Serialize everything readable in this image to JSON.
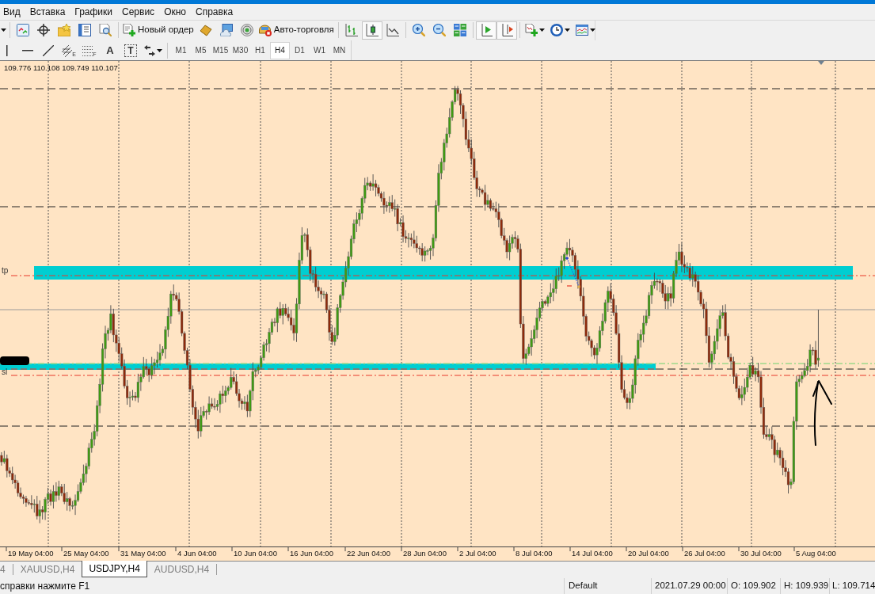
{
  "menu": [
    {
      "label": "Вид"
    },
    {
      "label": "Вставка"
    },
    {
      "label": "Графики"
    },
    {
      "label": "Сервис"
    },
    {
      "label": "Окно"
    },
    {
      "label": "Справка"
    }
  ],
  "toolbar": {
    "new_order": "Новый ордер",
    "auto_trading": "Авто-торговля",
    "chart_types": [
      {
        "kind": "bars",
        "selected": false
      },
      {
        "kind": "candles",
        "selected": true
      },
      {
        "kind": "line",
        "selected": false
      }
    ],
    "auto_scroll": {
      "on": true
    },
    "chart_shift": {
      "on": true
    }
  },
  "drawing_tools": [
    {
      "kind": "vertical_line"
    },
    {
      "kind": "horizontal_line"
    },
    {
      "kind": "trendline"
    },
    {
      "kind": "channel",
      "mark": "E"
    },
    {
      "kind": "fibonacci",
      "mark": "F"
    },
    {
      "kind": "text",
      "mark": "A"
    },
    {
      "kind": "text_label",
      "mark": "T"
    },
    {
      "kind": "arrows"
    }
  ],
  "timeframes": [
    {
      "label": "M1",
      "selected": false
    },
    {
      "label": "M5",
      "selected": false
    },
    {
      "label": "M15",
      "selected": false
    },
    {
      "label": "M30",
      "selected": false
    },
    {
      "label": "H1",
      "selected": false
    },
    {
      "label": "H4",
      "selected": true
    },
    {
      "label": "D1",
      "selected": false
    },
    {
      "label": "W1",
      "selected": false
    },
    {
      "label": "MN",
      "selected": false
    }
  ],
  "chart": {
    "ohlc": "109.776 110.108 109.749 110.107",
    "tp_label": "tp",
    "sl_label": "sl",
    "time_axis": [
      "19 May 04:00",
      "25 May 04:00",
      "31 May 04:00",
      "4 Jun 04:00",
      "10 Jun 04:00",
      "16 Jun 04:00",
      "22 Jun 04:00",
      "28 Jun 04:00",
      "2 Jul 04:00",
      "8 Jul 04:00",
      "14 Jul 04:00",
      "20 Jul 04:00",
      "26 Jul 04:00",
      "30 Jul 04:00",
      "5 Aug 04:00"
    ]
  },
  "tabs": [
    {
      "label": "4",
      "selected": false
    },
    {
      "label": "XAUUSD,H4",
      "selected": false
    },
    {
      "label": "USDJPY,H4",
      "selected": true
    },
    {
      "label": "AUDUSD,H4",
      "selected": false
    }
  ],
  "status_bar": {
    "hint": "справки нажмите F1",
    "profile": "Default",
    "time": "2021.07.29 00:00",
    "open": "O: 109.902",
    "high": "H: 109.939",
    "low": "L: 109.714"
  }
}
